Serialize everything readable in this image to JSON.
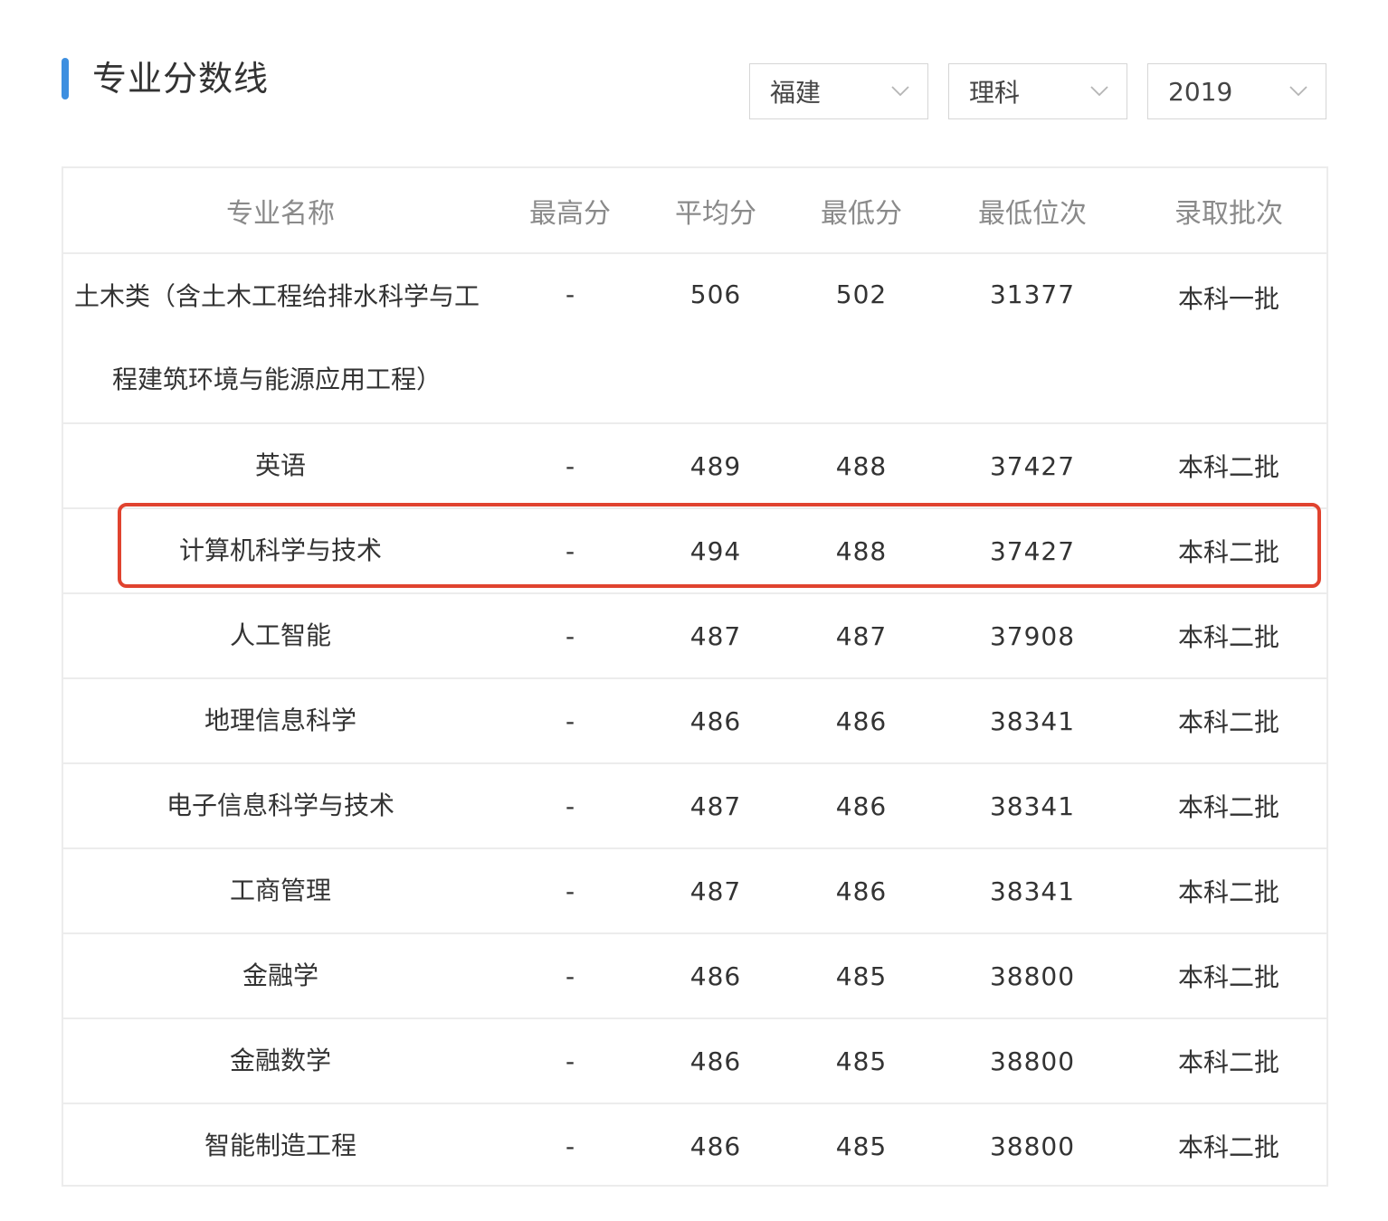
{
  "header": {
    "title": "专业分数线",
    "accent_color": "#3d8fe0"
  },
  "filters": {
    "province": "福建",
    "subject_type": "理科",
    "year": "2019"
  },
  "table": {
    "columns": [
      "专业名称",
      "最高分",
      "平均分",
      "最低分",
      "最低位次",
      "录取批次"
    ],
    "rows": [
      {
        "name_line1": "土木类（含土木工程给排水科学与工",
        "name_line2": "程建筑环境与能源应用工程）",
        "high": "-",
        "avg": "506",
        "low": "502",
        "rank": "31377",
        "batch": "本科一批"
      },
      {
        "name": "英语",
        "high": "-",
        "avg": "489",
        "low": "488",
        "rank": "37427",
        "batch": "本科二批"
      },
      {
        "name": "计算机科学与技术",
        "high": "-",
        "avg": "494",
        "low": "488",
        "rank": "37427",
        "batch": "本科二批"
      },
      {
        "name": "人工智能",
        "high": "-",
        "avg": "487",
        "low": "487",
        "rank": "37908",
        "batch": "本科二批"
      },
      {
        "name": "地理信息科学",
        "high": "-",
        "avg": "486",
        "low": "486",
        "rank": "38341",
        "batch": "本科二批"
      },
      {
        "name": "电子信息科学与技术",
        "high": "-",
        "avg": "487",
        "low": "486",
        "rank": "38341",
        "batch": "本科二批"
      },
      {
        "name": "工商管理",
        "high": "-",
        "avg": "487",
        "low": "486",
        "rank": "38341",
        "batch": "本科二批"
      },
      {
        "name": "金融学",
        "high": "-",
        "avg": "486",
        "low": "485",
        "rank": "38800",
        "batch": "本科二批"
      },
      {
        "name": "金融数学",
        "high": "-",
        "avg": "486",
        "low": "485",
        "rank": "38800",
        "batch": "本科二批"
      },
      {
        "name": "智能制造工程",
        "high": "-",
        "avg": "486",
        "low": "485",
        "rank": "38800",
        "batch": "本科二批"
      }
    ]
  },
  "highlight": {
    "color": "#e0432f",
    "row_index": 2
  },
  "icons": {
    "filter_chevron": "chevron-down-icon"
  }
}
